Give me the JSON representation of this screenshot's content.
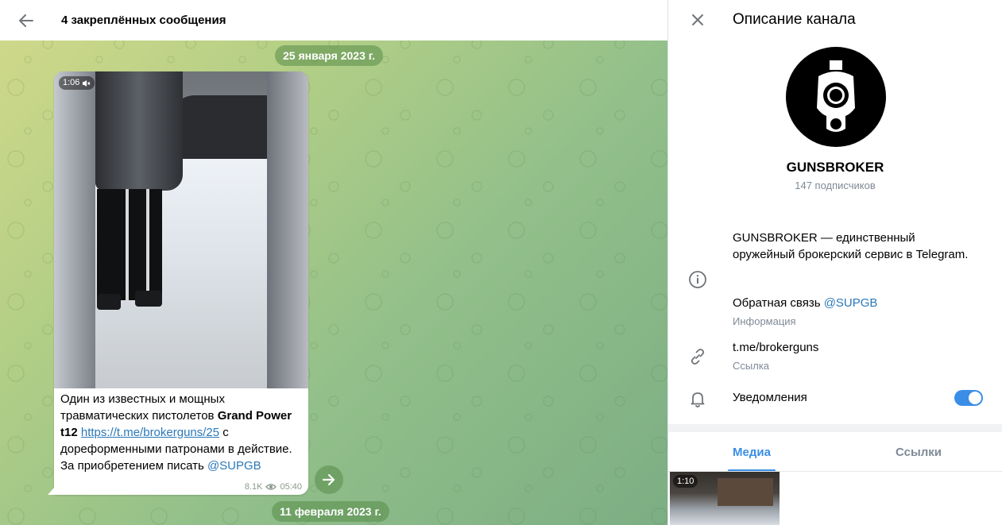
{
  "chat": {
    "header_title": "4 закреплённых сообщения",
    "date_top": "25 января 2023 г.",
    "date_bottom": "11 февраля 2023 г.",
    "message": {
      "video_duration": "1:06",
      "text_part1": "Один из известных и мощных травматических пистолетов ",
      "text_bold": "Grand Power t12",
      "text_space": " ",
      "link": "https://t.me/brokerguns/25",
      "text_part2": " с дореформенными патронами в действие. За приобретением писать ",
      "mention": "@SUPGB",
      "views": "8.1K",
      "time": "05:40"
    }
  },
  "panel": {
    "title": "Описание канала",
    "channel_name": "GUNSBROKER",
    "subscribers": "147 подписчиков",
    "description": "GUNSBROKER — единственный оружейный брокерский сервис в Telegram.",
    "feedback_label": "Обратная связь ",
    "feedback_mention": "@SUPGB",
    "info_label": "Информация",
    "link": "t.me/brokerguns",
    "link_label": "Ссылка",
    "notifications": "Уведомления",
    "notifications_enabled": true,
    "tabs": [
      {
        "label": "Медиа",
        "active": true
      },
      {
        "label": "Ссылки",
        "active": false
      }
    ],
    "media_thumb_duration": "1:10"
  },
  "colors": {
    "accent": "#3a8ee6",
    "link": "#2a78b8",
    "muted": "#7f8a96"
  },
  "icons": [
    "back-arrow-icon",
    "close-icon",
    "muted-icon",
    "eye-icon",
    "forward-arrow-icon",
    "info-icon",
    "link-icon",
    "bell-icon"
  ]
}
